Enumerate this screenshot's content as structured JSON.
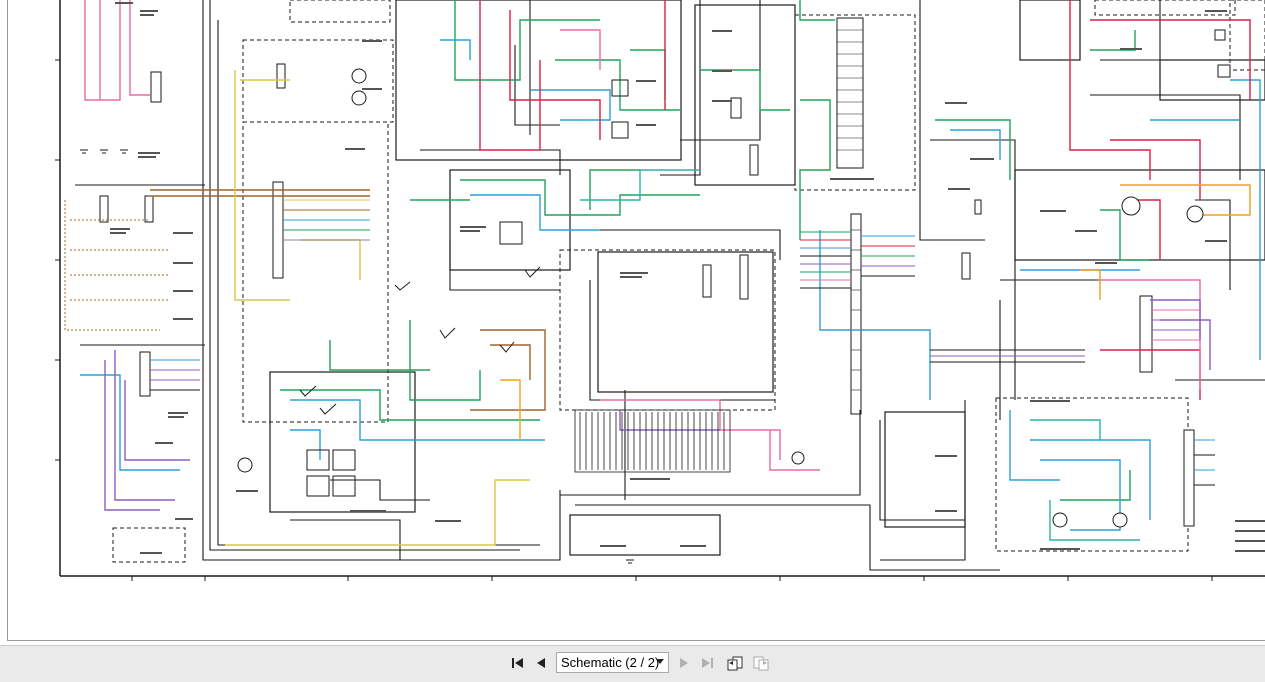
{
  "document": {
    "sheet_label": "Schematic (2 / 2)"
  },
  "toolbar": {
    "page_selector_value": "Schematic (2 / 2)",
    "buttons": [
      {
        "name": "first-page-button",
        "icon": "first-page-icon"
      },
      {
        "name": "previous-page-button",
        "icon": "previous-page-icon"
      },
      {
        "name": "next-page-button",
        "icon": "next-page-icon"
      },
      {
        "name": "last-page-button",
        "icon": "last-page-icon"
      },
      {
        "name": "previous-view-button",
        "icon": "previous-view-icon"
      },
      {
        "name": "next-view-button",
        "icon": "next-view-icon"
      }
    ]
  },
  "colors": {
    "wire_black": "#1a1a1a",
    "wire_green": "#1fa35a",
    "wire_blue": "#2aa0d8",
    "wire_red": "#d8204a",
    "wire_pink": "#e86aa6",
    "wire_purple": "#8b5fc0",
    "wire_brown": "#a0642a",
    "wire_orange": "#f0a020",
    "wire_yellow": "#d8c64a",
    "wire_teal": "#2bb3a8",
    "wire_gray": "#8a8a8a",
    "toolbar_bg": "#eaeaea"
  }
}
